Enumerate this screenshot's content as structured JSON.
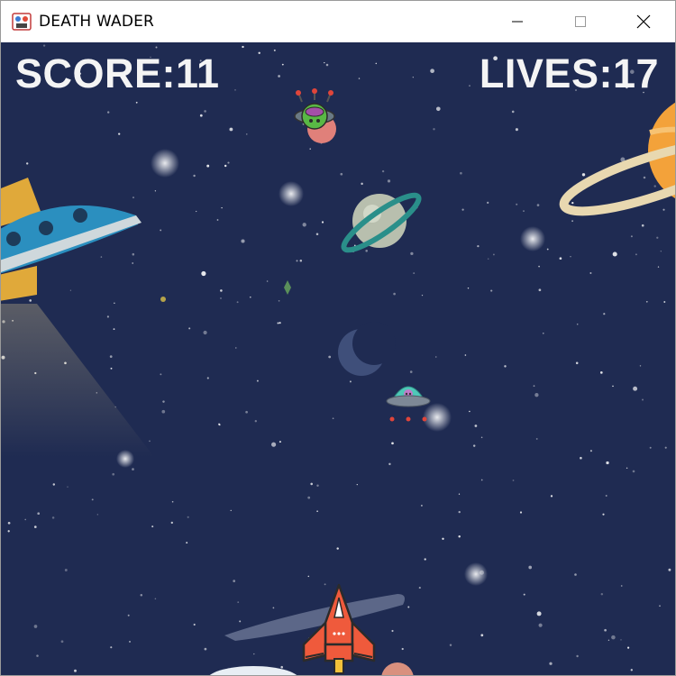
{
  "window": {
    "title": "DEATH WADER",
    "controls": {
      "minimize_icon": "minimize-icon",
      "maximize_icon": "maximize-icon",
      "close_icon": "close-icon"
    }
  },
  "hud": {
    "score_text": "SCORE:11",
    "lives_text": "LIVES:17"
  },
  "sprites": {
    "player": "red-rocket-ship",
    "enemy_1": "green-alien-ufo",
    "enemy_2": "teal-flying-saucer"
  },
  "colors": {
    "space_background": "#1f2b52",
    "hud_text": "#f4f4f4",
    "player_ship": "#ef5a3c"
  }
}
